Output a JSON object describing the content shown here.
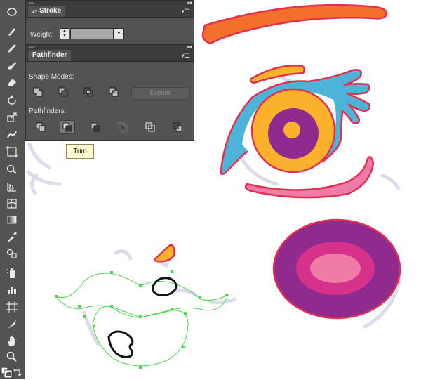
{
  "stroke_panel": {
    "title": "Stroke",
    "weight_label": "Weight:",
    "weight_value": ""
  },
  "pathfinder_panel": {
    "title": "Pathfinder",
    "shape_modes_label": "Shape Modes:",
    "shape_modes": [
      "unite",
      "minus-front",
      "intersect",
      "exclude"
    ],
    "expand_label": "Expand",
    "pathfinders_label": "Pathfinders:",
    "pathfinders": [
      "divide",
      "trim",
      "merge",
      "crop",
      "outline",
      "minus-back"
    ],
    "active_pathfinder": "trim"
  },
  "tooltip": {
    "text": "Trim"
  },
  "toolbar": {
    "tools": [
      "ellipse",
      "paintbrush",
      "pencil",
      "blob-brush",
      "eraser",
      "rotate",
      "scale",
      "warp",
      "free-transform",
      "shape-builder",
      "perspective-grid",
      "mesh",
      "gradient",
      "eyedropper",
      "blend",
      "symbol-sprayer",
      "column-graph",
      "artboard",
      "slice",
      "hand",
      "zoom",
      "fill-stroke",
      "swap-fill-stroke"
    ]
  },
  "colors": {
    "orange": "#f36f2c",
    "yellow": "#fbb12c",
    "purple": "#8f2a8f",
    "magenta": "#d6328c",
    "pink": "#f07aa8",
    "blue": "#4db3d8",
    "red_stroke": "#e42f4f",
    "selection_green": "#4cd84c"
  }
}
